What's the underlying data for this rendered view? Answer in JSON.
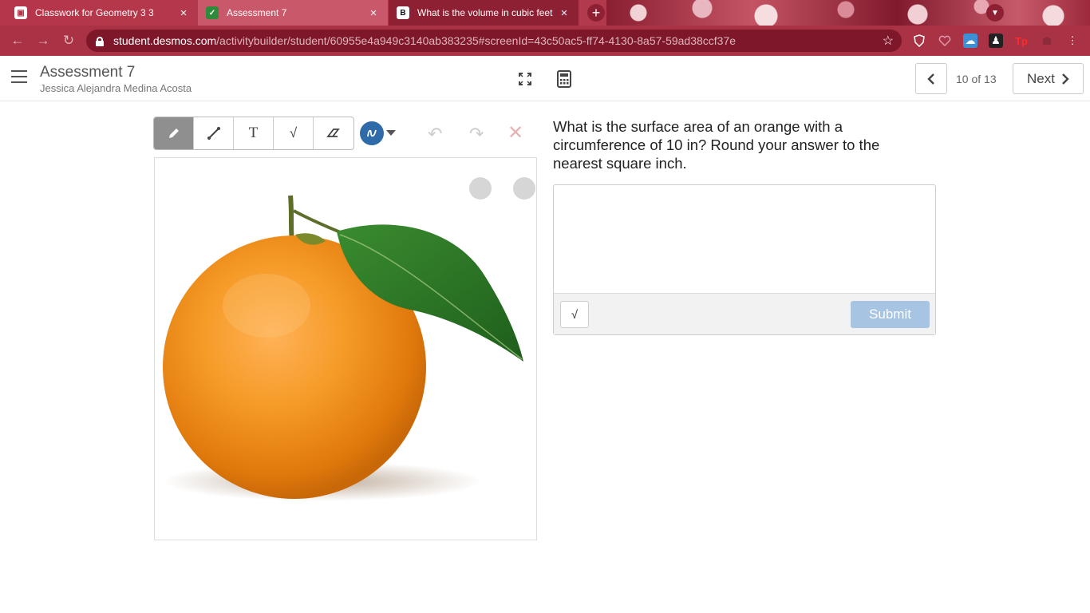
{
  "browser": {
    "tabs": [
      {
        "title": "Classwork for Geometry 3 3",
        "close": "×"
      },
      {
        "title": "Assessment 7",
        "close": "×"
      },
      {
        "title": "What is the volume in cubic feet",
        "close": "×"
      }
    ],
    "new_tab": "+",
    "url_host": "student.desmos.com",
    "url_path": "/activitybuilder/student/60955e4a949c3140ab383235#screenId=43c50ac5-ff74-4130-8a57-59ad38ccf37e"
  },
  "header": {
    "title": "Assessment 7",
    "student_name": "Jessica Alejandra Medina Acosta",
    "page_indicator": "10 of 13",
    "next_label": "Next"
  },
  "toolbar": {
    "text_tool_glyph": "T",
    "math_tool_glyph": "√",
    "undo_glyph": "↶",
    "redo_glyph": "↷",
    "clear_glyph": "✕"
  },
  "question": {
    "prompt": "What is the surface area of an orange with a circumference of 10 in? Round your answer to the nearest square inch.",
    "answer_value": "",
    "math_button_glyph": "√",
    "submit_label": "Submit"
  },
  "colors": {
    "browser_accent": "#b5364a",
    "submit_disabled": "#a8c4e3",
    "pen_color": "#2f6ba8",
    "orange": "#f28c1a",
    "leaf": "#2f7a2a"
  }
}
